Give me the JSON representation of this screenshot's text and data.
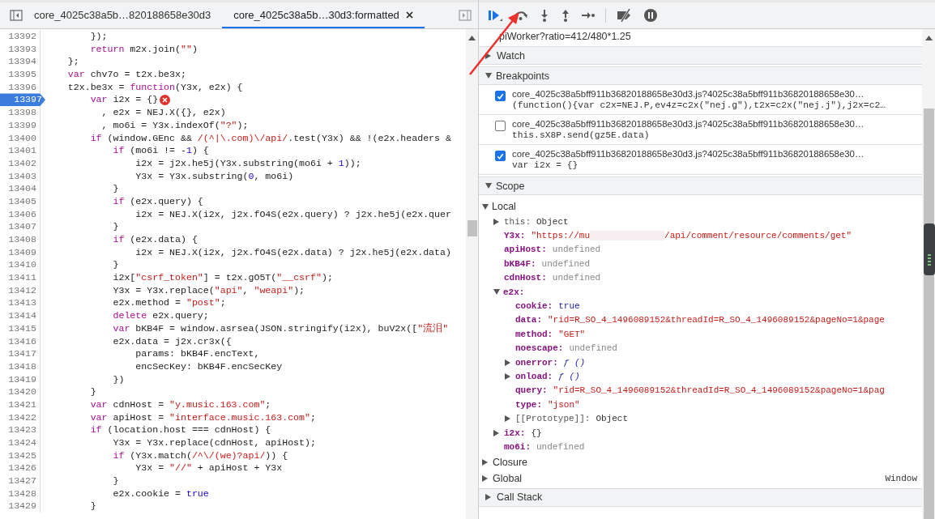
{
  "editor": {
    "tabs": [
      {
        "label": "core_4025c38a5b…820188658e30d3",
        "selected": false,
        "closable": false
      },
      {
        "label": "core_4025c38a5b…30d3:formatted",
        "selected": true,
        "closable": true
      }
    ],
    "lines": [
      {
        "number": "13392",
        "breakpoint": false,
        "error": false,
        "tokens": [
          {
            "kind": "plain",
            "text": "        });"
          }
        ]
      },
      {
        "number": "13393",
        "breakpoint": false,
        "error": false,
        "tokens": [
          {
            "kind": "keyword",
            "text": "        return"
          },
          {
            "kind": "plain",
            "text": " m2x.join("
          },
          {
            "kind": "string",
            "text": "\"\""
          },
          {
            "kind": "plain",
            "text": ")"
          }
        ]
      },
      {
        "number": "13394",
        "breakpoint": false,
        "error": false,
        "tokens": [
          {
            "kind": "plain",
            "text": "    };"
          }
        ]
      },
      {
        "number": "13395",
        "breakpoint": false,
        "error": false,
        "tokens": [
          {
            "kind": "keyword",
            "text": "    var"
          },
          {
            "kind": "plain",
            "text": " chv7o = t2x.be3x;"
          }
        ]
      },
      {
        "number": "13396",
        "breakpoint": false,
        "error": false,
        "tokens": [
          {
            "kind": "plain",
            "text": "    t2x.be3x = "
          },
          {
            "kind": "keyword",
            "text": "function"
          },
          {
            "kind": "plain",
            "text": "(Y3x, e2x) {"
          }
        ]
      },
      {
        "number": "13397",
        "breakpoint": true,
        "error": true,
        "tokens": [
          {
            "kind": "keyword",
            "text": "        var"
          },
          {
            "kind": "plain",
            "text": " i2x = {}"
          }
        ]
      },
      {
        "number": "13398",
        "breakpoint": false,
        "error": false,
        "tokens": [
          {
            "kind": "plain",
            "text": "          , e2x = NEJ.X({}, e2x)"
          }
        ]
      },
      {
        "number": "13399",
        "breakpoint": false,
        "error": false,
        "tokens": [
          {
            "kind": "plain",
            "text": "          , mo6i = Y3x.indexOf("
          },
          {
            "kind": "string",
            "text": "\"?\""
          },
          {
            "kind": "plain",
            "text": ");"
          }
        ]
      },
      {
        "number": "13400",
        "breakpoint": false,
        "error": false,
        "tokens": [
          {
            "kind": "keyword",
            "text": "        if"
          },
          {
            "kind": "plain",
            "text": " (window.GEnc && "
          },
          {
            "kind": "string",
            "text": "/(^|\\.com)\\/api/"
          },
          {
            "kind": "plain",
            "text": ".test(Y3x) && !(e2x.headers &"
          }
        ]
      },
      {
        "number": "13401",
        "breakpoint": false,
        "error": false,
        "tokens": [
          {
            "kind": "keyword",
            "text": "            if"
          },
          {
            "kind": "plain",
            "text": " (mo6i != -"
          },
          {
            "kind": "number",
            "text": "1"
          },
          {
            "kind": "plain",
            "text": ") {"
          }
        ]
      },
      {
        "number": "13402",
        "breakpoint": false,
        "error": false,
        "tokens": [
          {
            "kind": "plain",
            "text": "                i2x = j2x.he5j(Y3x.substring(mo6i + "
          },
          {
            "kind": "number",
            "text": "1"
          },
          {
            "kind": "plain",
            "text": "));"
          }
        ]
      },
      {
        "number": "13403",
        "breakpoint": false,
        "error": false,
        "tokens": [
          {
            "kind": "plain",
            "text": "                Y3x = Y3x.substring("
          },
          {
            "kind": "number",
            "text": "0"
          },
          {
            "kind": "plain",
            "text": ", mo6i)"
          }
        ]
      },
      {
        "number": "13404",
        "breakpoint": false,
        "error": false,
        "tokens": [
          {
            "kind": "plain",
            "text": "            }"
          }
        ]
      },
      {
        "number": "13405",
        "breakpoint": false,
        "error": false,
        "tokens": [
          {
            "kind": "keyword",
            "text": "            if"
          },
          {
            "kind": "plain",
            "text": " (e2x.query) {"
          }
        ]
      },
      {
        "number": "13406",
        "breakpoint": false,
        "error": false,
        "tokens": [
          {
            "kind": "plain",
            "text": "                i2x = NEJ.X(i2x, j2x.fO4S(e2x.query) ? j2x.he5j(e2x.quer"
          }
        ]
      },
      {
        "number": "13407",
        "breakpoint": false,
        "error": false,
        "tokens": [
          {
            "kind": "plain",
            "text": "            }"
          }
        ]
      },
      {
        "number": "13408",
        "breakpoint": false,
        "error": false,
        "tokens": [
          {
            "kind": "keyword",
            "text": "            if"
          },
          {
            "kind": "plain",
            "text": " (e2x.data) {"
          }
        ]
      },
      {
        "number": "13409",
        "breakpoint": false,
        "error": false,
        "tokens": [
          {
            "kind": "plain",
            "text": "                i2x = NEJ.X(i2x, j2x.fO4S(e2x.data) ? j2x.he5j(e2x.data)"
          }
        ]
      },
      {
        "number": "13410",
        "breakpoint": false,
        "error": false,
        "tokens": [
          {
            "kind": "plain",
            "text": "            }"
          }
        ]
      },
      {
        "number": "13411",
        "breakpoint": false,
        "error": false,
        "tokens": [
          {
            "kind": "plain",
            "text": "            i2x["
          },
          {
            "kind": "string",
            "text": "\"csrf_token\""
          },
          {
            "kind": "plain",
            "text": "] = t2x.gO5T("
          },
          {
            "kind": "string",
            "text": "\"__csrf\""
          },
          {
            "kind": "plain",
            "text": ");"
          }
        ]
      },
      {
        "number": "13412",
        "breakpoint": false,
        "error": false,
        "tokens": [
          {
            "kind": "plain",
            "text": "            Y3x = Y3x.replace("
          },
          {
            "kind": "string",
            "text": "\"api\""
          },
          {
            "kind": "plain",
            "text": ", "
          },
          {
            "kind": "string",
            "text": "\"weapi\""
          },
          {
            "kind": "plain",
            "text": ");"
          }
        ]
      },
      {
        "number": "13413",
        "breakpoint": false,
        "error": false,
        "tokens": [
          {
            "kind": "plain",
            "text": "            e2x.method = "
          },
          {
            "kind": "string",
            "text": "\"post\""
          },
          {
            "kind": "plain",
            "text": ";"
          }
        ]
      },
      {
        "number": "13414",
        "breakpoint": false,
        "error": false,
        "tokens": [
          {
            "kind": "keyword",
            "text": "            delete"
          },
          {
            "kind": "plain",
            "text": " e2x.query;"
          }
        ]
      },
      {
        "number": "13415",
        "breakpoint": false,
        "error": false,
        "tokens": [
          {
            "kind": "keyword",
            "text": "            var"
          },
          {
            "kind": "plain",
            "text": " bKB4F = window.asrsea(JSON.stringify(i2x), buV2x(["
          },
          {
            "kind": "string",
            "text": "\"流泪\""
          }
        ]
      },
      {
        "number": "13416",
        "breakpoint": false,
        "error": false,
        "tokens": [
          {
            "kind": "plain",
            "text": "            e2x.data = j2x.cr3x({"
          }
        ]
      },
      {
        "number": "13417",
        "breakpoint": false,
        "error": false,
        "tokens": [
          {
            "kind": "plain",
            "text": "                params: bKB4F.encText,"
          }
        ]
      },
      {
        "number": "13418",
        "breakpoint": false,
        "error": false,
        "tokens": [
          {
            "kind": "plain",
            "text": "                encSecKey: bKB4F.encSecKey"
          }
        ]
      },
      {
        "number": "13419",
        "breakpoint": false,
        "error": false,
        "tokens": [
          {
            "kind": "plain",
            "text": "            })"
          }
        ]
      },
      {
        "number": "13420",
        "breakpoint": false,
        "error": false,
        "tokens": [
          {
            "kind": "plain",
            "text": "        }"
          }
        ]
      },
      {
        "number": "13421",
        "breakpoint": false,
        "error": false,
        "tokens": [
          {
            "kind": "keyword",
            "text": "        var"
          },
          {
            "kind": "plain",
            "text": " cdnHost = "
          },
          {
            "kind": "string",
            "text": "\"y.music.163.com\""
          },
          {
            "kind": "plain",
            "text": ";"
          }
        ]
      },
      {
        "number": "13422",
        "breakpoint": false,
        "error": false,
        "tokens": [
          {
            "kind": "keyword",
            "text": "        var"
          },
          {
            "kind": "plain",
            "text": " apiHost = "
          },
          {
            "kind": "string",
            "text": "\"interface.music.163.com\""
          },
          {
            "kind": "plain",
            "text": ";"
          }
        ]
      },
      {
        "number": "13423",
        "breakpoint": false,
        "error": false,
        "tokens": [
          {
            "kind": "keyword",
            "text": "        if"
          },
          {
            "kind": "plain",
            "text": " (location.host === cdnHost) {"
          }
        ]
      },
      {
        "number": "13424",
        "breakpoint": false,
        "error": false,
        "tokens": [
          {
            "kind": "plain",
            "text": "            Y3x = Y3x.replace(cdnHost, apiHost);"
          }
        ]
      },
      {
        "number": "13425",
        "breakpoint": false,
        "error": false,
        "tokens": [
          {
            "kind": "keyword",
            "text": "            if"
          },
          {
            "kind": "plain",
            "text": " (Y3x.match("
          },
          {
            "kind": "string",
            "text": "/^\\/(we)?api/"
          },
          {
            "kind": "plain",
            "text": ")) {"
          }
        ]
      },
      {
        "number": "13426",
        "breakpoint": false,
        "error": false,
        "tokens": [
          {
            "kind": "plain",
            "text": "                Y3x = "
          },
          {
            "kind": "string",
            "text": "\"//\""
          },
          {
            "kind": "plain",
            "text": " + apiHost + Y3x"
          }
        ]
      },
      {
        "number": "13427",
        "breakpoint": false,
        "error": false,
        "tokens": [
          {
            "kind": "plain",
            "text": "            }"
          }
        ]
      },
      {
        "number": "13428",
        "breakpoint": false,
        "error": false,
        "tokens": [
          {
            "kind": "plain",
            "text": "            e2x.cookie = "
          },
          {
            "kind": "number",
            "text": "true"
          }
        ]
      },
      {
        "number": "13429",
        "breakpoint": false,
        "error": false,
        "tokens": [
          {
            "kind": "plain",
            "text": "        }"
          }
        ]
      }
    ]
  },
  "debugger": {
    "top_line": "piWorker?ratio=412/480*1.25",
    "sections": [
      {
        "kind": "watch",
        "title": "Watch",
        "expanded": false
      },
      {
        "kind": "breakpoints",
        "title": "Breakpoints",
        "expanded": true,
        "items": [
          {
            "checked": true,
            "location": "core_4025c38a5bff911b36820188658e30d3.js?4025c38a5bff911b36820188658e30…",
            "code": "(function(){var c2x=NEJ.P,ev4z=c2x(\"nej.g\"),t2x=c2x(\"nej.j\"),j2x=c2…"
          },
          {
            "checked": false,
            "location": "core_4025c38a5bff911b36820188658e30d3.js?4025c38a5bff911b36820188658e30…",
            "code": "this.sX8P.send(gz5E.data)"
          },
          {
            "checked": true,
            "location": "core_4025c38a5bff911b36820188658e30d3.js?4025c38a5bff911b36820188658e30…",
            "code": "var i2x = {}"
          }
        ]
      },
      {
        "kind": "scope",
        "title": "Scope",
        "expanded": true,
        "entries": [
          {
            "kind": "scope",
            "name": "Local",
            "expandable": true,
            "expanded": true,
            "children": [
              {
                "kind": "special",
                "name": "this:",
                "value": {
                  "kind": "object",
                  "text": "Object"
                },
                "expandable": true,
                "expanded": false
              },
              {
                "kind": "own",
                "name": "Y3x:",
                "value": {
                  "kind": "string",
                  "text": "\"https://mu"
                },
                "redacted_tail": "/api/comment/resource/comments/get\"",
                "expandable": false,
                "expanded": false
              },
              {
                "kind": "own",
                "name": "apiHost:",
                "value": {
                  "kind": "undefined",
                  "text": "undefined"
                },
                "expandable": false,
                "expanded": false
              },
              {
                "kind": "own",
                "name": "bKB4F:",
                "value": {
                  "kind": "undefined",
                  "text": "undefined"
                },
                "expandable": false,
                "expanded": false
              },
              {
                "kind": "own",
                "name": "cdnHost:",
                "value": {
                  "kind": "undefined",
                  "text": "undefined"
                },
                "expandable": false,
                "expanded": false
              },
              {
                "kind": "own",
                "name": "e2x:",
                "expandable": true,
                "expanded": true,
                "children": [
                  {
                    "kind": "own",
                    "name": "cookie:",
                    "value": {
                      "kind": "boolean",
                      "text": "true"
                    },
                    "expandable": false,
                    "expanded": false
                  },
                  {
                    "kind": "own",
                    "name": "data:",
                    "value": {
                      "kind": "string",
                      "text": "\"rid=R_SO_4_1496089152&threadId=R_SO_4_1496089152&pageNo=1&page"
                    },
                    "expandable": false,
                    "expanded": false
                  },
                  {
                    "kind": "own",
                    "name": "method:",
                    "value": {
                      "kind": "string",
                      "text": "\"GET\""
                    },
                    "expandable": false,
                    "expanded": false
                  },
                  {
                    "kind": "own",
                    "name": "noescape:",
                    "value": {
                      "kind": "undefined",
                      "text": "undefined"
                    },
                    "expandable": false,
                    "expanded": false
                  },
                  {
                    "kind": "own",
                    "name": "onerror:",
                    "value": {
                      "kind": "function",
                      "text": "ƒ ()"
                    },
                    "expandable": true,
                    "expanded": false
                  },
                  {
                    "kind": "own",
                    "name": "onload:",
                    "value": {
                      "kind": "function",
                      "text": "ƒ ()"
                    },
                    "expandable": true,
                    "expanded": false
                  },
                  {
                    "kind": "own",
                    "name": "query:",
                    "value": {
                      "kind": "string",
                      "text": "\"rid=R_SO_4_1496089152&threadId=R_SO_4_1496089152&pageNo=1&pag"
                    },
                    "expandable": false,
                    "expanded": false
                  },
                  {
                    "kind": "own",
                    "name": "type:",
                    "value": {
                      "kind": "string",
                      "text": "\"json\""
                    },
                    "expandable": false,
                    "expanded": false
                  },
                  {
                    "kind": "special",
                    "name": "[[Prototype]]:",
                    "value": {
                      "kind": "object",
                      "text": "Object"
                    },
                    "expandable": true,
                    "expanded": false
                  }
                ]
              },
              {
                "kind": "own",
                "name": "i2x:",
                "value": {
                  "kind": "object",
                  "text": "{}"
                },
                "expandable": true,
                "expanded": false
              },
              {
                "kind": "own",
                "name": "mo6i:",
                "value": {
                  "kind": "undefined",
                  "text": "undefined"
                },
                "expandable": false,
                "expanded": false
              }
            ]
          },
          {
            "kind": "scope",
            "name": "Closure",
            "expandable": true,
            "expanded": false
          },
          {
            "kind": "scope",
            "name": "Global",
            "value": {
              "kind": "object",
              "text": "Window"
            },
            "expandable": true,
            "expanded": false
          }
        ]
      },
      {
        "kind": "call_stack",
        "title": "Call Stack",
        "expanded": false
      }
    ]
  }
}
